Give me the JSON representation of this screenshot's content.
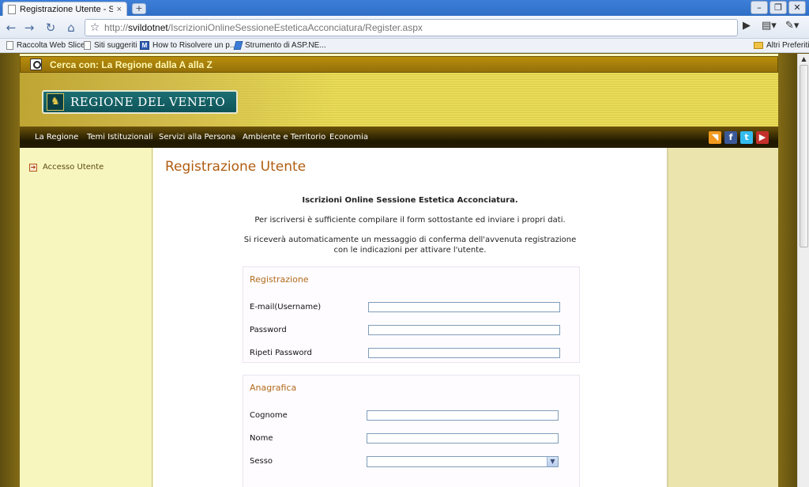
{
  "browser": {
    "tab_title": "Registrazione Utente - Sito...",
    "tab_close": "×",
    "new_tab": "+",
    "window_buttons": [
      "–",
      "❐",
      "✕"
    ],
    "url_prefix": "http://",
    "url_host": "svildotnet",
    "url_path": "/IscrizioniOnlineSessioneEsteticaAcconciatura/Register.aspx",
    "bookmarks": [
      "Raccolta Web Slice",
      "Siti suggeriti",
      "How to Risolvere un p...",
      "Strumento di ASP.NE..."
    ],
    "other_bookmarks": "Altri Preferiti",
    "bookmark_m_icon": "M"
  },
  "site": {
    "search_text": "Cerca con: La Regione dalla A alla Z",
    "logo_text": "REGIONE DEL VENETO",
    "logo_icon": "♞",
    "menu": [
      "La Regione",
      "Temi Istituzionali",
      "Servizi alla Persona",
      "Ambiente e Territorio",
      "Economia"
    ],
    "social": {
      "rss": "◥",
      "facebook": "f",
      "twitter": "t",
      "youtube": "▶"
    },
    "social_colors": {
      "rss": "#f29a1f",
      "facebook": "#3b5998",
      "twitter": "#33bbee",
      "youtube": "#c4302b"
    }
  },
  "sidebar": {
    "items": [
      {
        "label": "Accesso Utente",
        "bullet": "➜"
      }
    ]
  },
  "main": {
    "title": "Registrazione Utente",
    "intro_bold": "Iscrizioni Online Sessione Estetica Acconciatura.",
    "intro_line1": "Per iscriversi è sufficiente compilare il form sottostante ed inviare i propri dati.",
    "intro_line2a": "Si riceverà automaticamente un messaggio di conferma dell'avvenuta registrazione",
    "intro_line2b": "con le indicazioni per attivare l'utente.",
    "registrazione": {
      "legend": "Registrazione",
      "email_label": "E-mail(Username)",
      "email_value": "",
      "password_label": "Password",
      "password_value": "",
      "repeat_label": "Ripeti Password",
      "repeat_value": ""
    },
    "anagrafica": {
      "legend": "Anagrafica",
      "cognome_label": "Cognome",
      "cognome_value": "",
      "nome_label": "Nome",
      "nome_value": "",
      "sesso_label": "Sesso",
      "sesso_value": ""
    }
  },
  "colors": {
    "accent": "#b05d10",
    "menu_bg": "#231b02",
    "page_bg": "#f8f6bf"
  }
}
